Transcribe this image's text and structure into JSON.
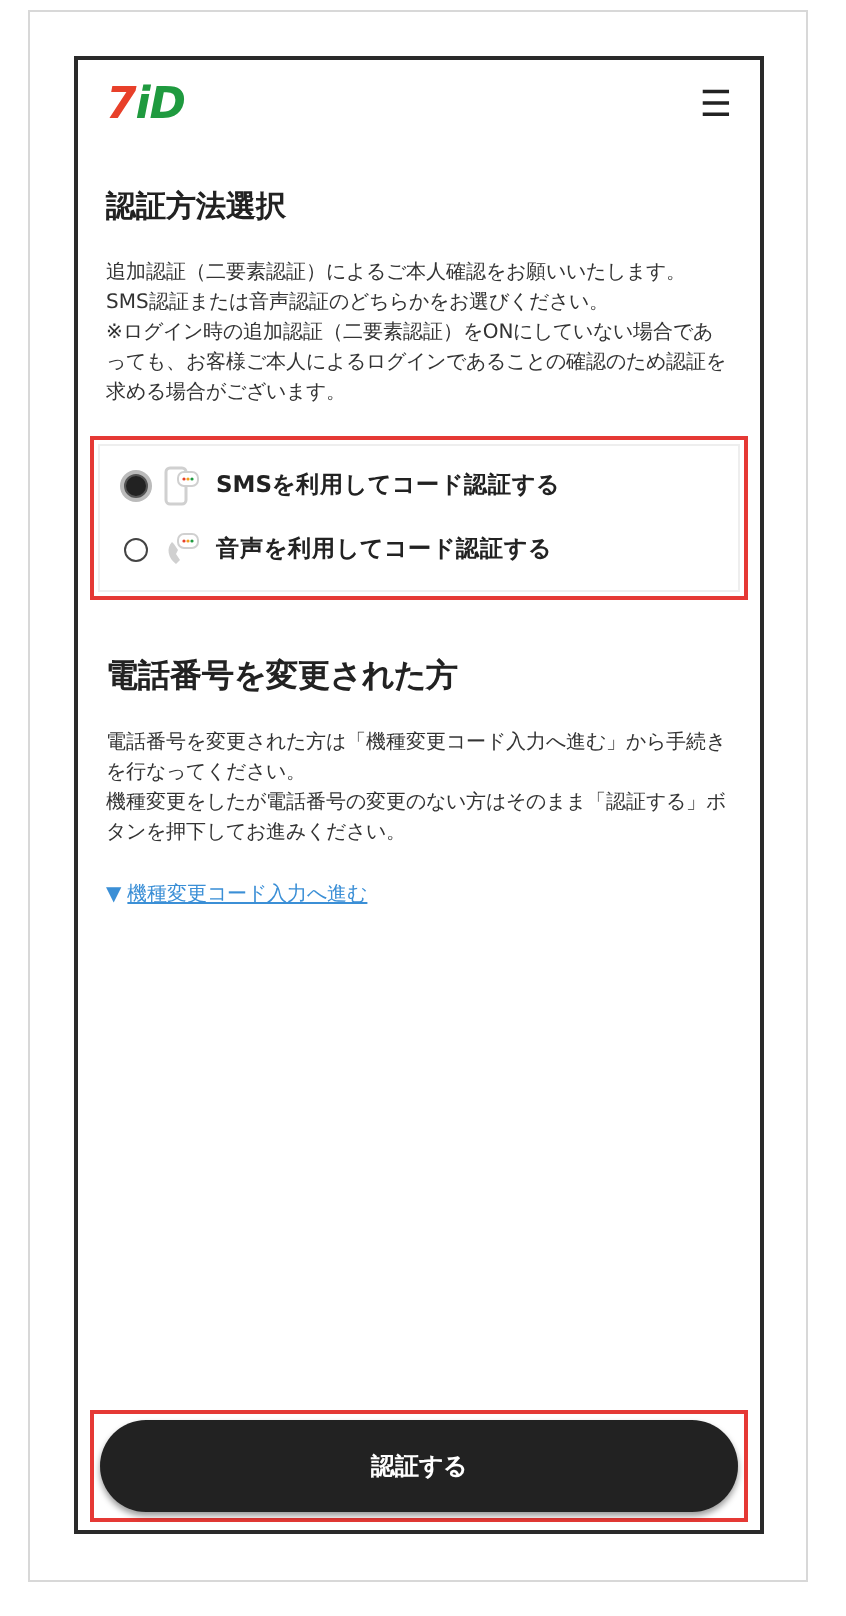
{
  "header": {
    "logo": [
      {
        "text": "7",
        "color": "#e8402a"
      },
      {
        "text": "iD",
        "color": "#1f9a3f"
      }
    ],
    "menu_icon": "☰"
  },
  "auth_section": {
    "title": "認証方法選択",
    "description": [
      "追加認証（二要素認証）によるご本人確認をお願いいたします。",
      "SMS認証または音声認証のどちらかをお選びください。",
      "※ログイン時の追加認証（二要素認証）をONにしていない場合であっても、お客様ご本人によるログインであることの確認のため認証を求める場合がございます。"
    ],
    "highlighted": true,
    "options": [
      {
        "kind": "sms",
        "label": "SMSを利用してコード認証する",
        "selected": true
      },
      {
        "kind": "voice",
        "label": "音声を利用してコード認証する",
        "selected": false
      }
    ]
  },
  "phone_change_section": {
    "title": "電話番号を変更された方",
    "description": [
      "電話番号を変更された方は「機種変更コード入力へ進む」から手続きを行なってください。",
      "機種変更をしたが電話番号の変更のない方はそのまま「認証する」ボタンを押下してお進みください。"
    ],
    "link": {
      "marker": "▼",
      "label": "機種変更コード入力へ進む"
    }
  },
  "submit": {
    "label": "認証する",
    "highlighted": true
  }
}
